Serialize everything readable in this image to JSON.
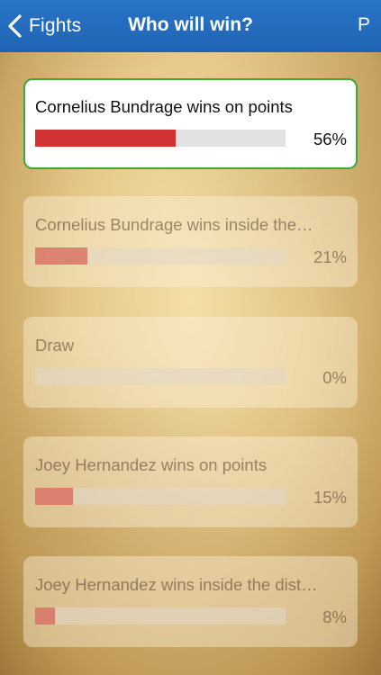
{
  "navbar": {
    "back_label": "Fights",
    "title": "Who will win?",
    "right_label": "P"
  },
  "options": [
    {
      "label": "Cornelius Bundrage wins on points",
      "percent_text": "56%",
      "percent": 56,
      "selected": true
    },
    {
      "label": "Cornelius Bundrage wins inside the…",
      "percent_text": "21%",
      "percent": 21,
      "selected": false
    },
    {
      "label": "Draw",
      "percent_text": "0%",
      "percent": 0,
      "selected": false
    },
    {
      "label": "Joey Hernandez wins on points",
      "percent_text": "15%",
      "percent": 15,
      "selected": false
    },
    {
      "label": "Joey Hernandez wins inside the dist…",
      "percent_text": "8%",
      "percent": 8,
      "selected": false
    }
  ],
  "colors": {
    "navbar": "#2a74c6",
    "selected_border": "#3bab38",
    "bar_fill": "#d13234"
  }
}
